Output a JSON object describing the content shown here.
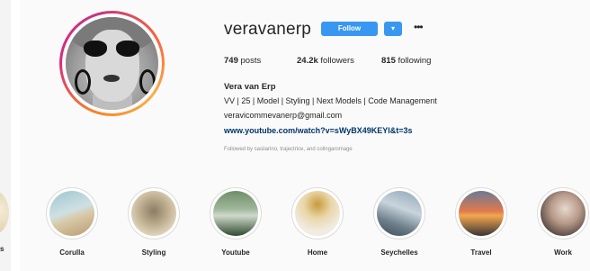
{
  "profile": {
    "username": "veravanerp",
    "follow_label": "Follow",
    "dropdown_icon": "chevron-down-icon",
    "more_icon": "more-options-icon"
  },
  "stats": {
    "posts_count": "749",
    "posts_label": "posts",
    "followers_count": "24.2k",
    "followers_label": "followers",
    "following_count": "815",
    "following_label": "following"
  },
  "bio": {
    "name": "Vera van Erp",
    "line1": "VV | 25 | Model | Styling | Next Models | Code Management",
    "email": "veravicommevanerp@gmail.com",
    "link": "www.youtube.com/watch?v=sWyBX49KEYl&t=3s",
    "followed_by": "Followed by sasiiarino, trajectrice, and colingaromage"
  },
  "highlights": [
    {
      "label": "Corulla"
    },
    {
      "label": "Styling"
    },
    {
      "label": "Youtube"
    },
    {
      "label": "Home"
    },
    {
      "label": "Seychelles"
    },
    {
      "label": "Travel"
    },
    {
      "label": "Work"
    }
  ],
  "partial_highlight": {
    "label": "s"
  },
  "colors": {
    "accent": "#3897f0",
    "link": "#003569",
    "background": "#fafafa"
  }
}
